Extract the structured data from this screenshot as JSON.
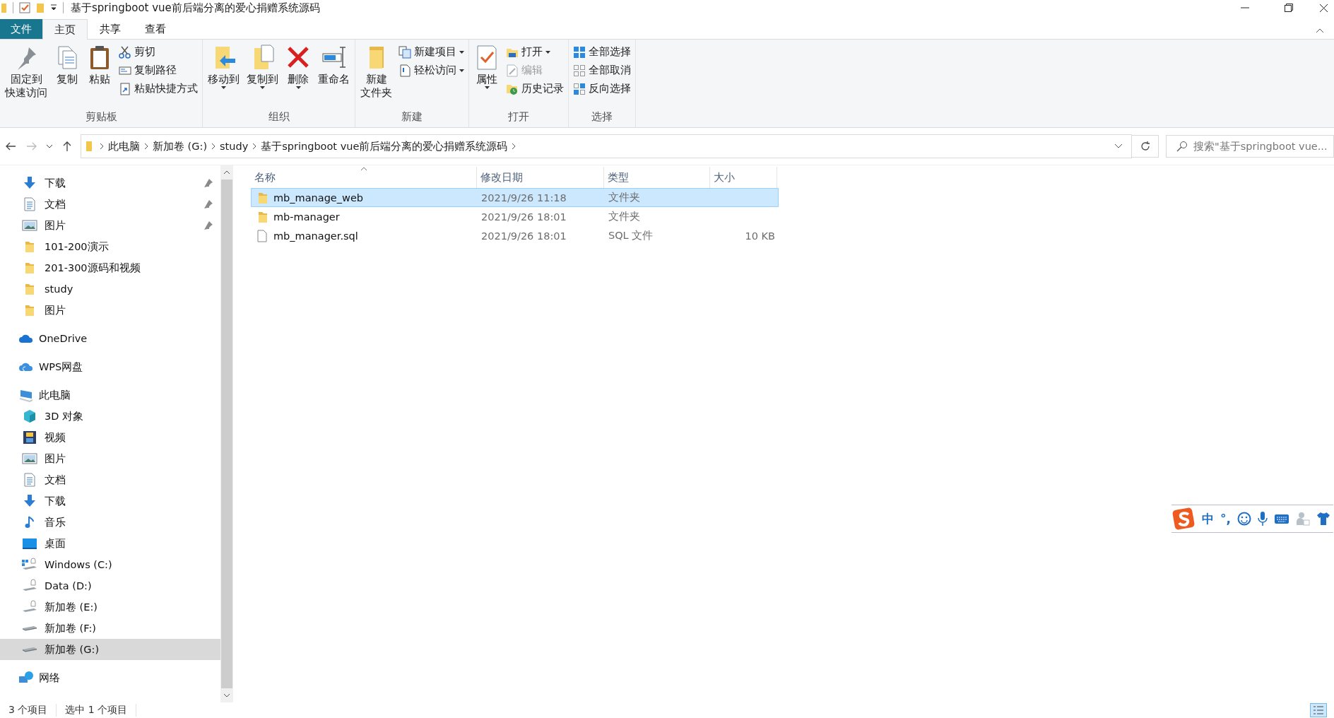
{
  "window": {
    "title": "基于springboot vue前后端分离的爱心捐赠系统源码"
  },
  "ribbon_tabs": [
    {
      "label": "文件",
      "kind": "file",
      "selected": false
    },
    {
      "label": "主页",
      "kind": "tab",
      "selected": true
    },
    {
      "label": "共享",
      "kind": "tab",
      "selected": false
    },
    {
      "label": "查看",
      "kind": "tab",
      "selected": false
    }
  ],
  "ribbon_groups": [
    {
      "label": "剪贴板",
      "items": [
        {
          "label_lines": [
            "固定到",
            "快速访问"
          ],
          "kind": "large",
          "dropdown": false,
          "disabled": false
        },
        {
          "label_lines": [
            "复制"
          ],
          "kind": "large",
          "dropdown": false,
          "disabled": false
        },
        {
          "label_lines": [
            "粘贴"
          ],
          "kind": "large",
          "dropdown": false,
          "disabled": false
        },
        {
          "label": "剪切",
          "kind": "small",
          "dropdown": false,
          "disabled": false
        },
        {
          "label": "复制路径",
          "kind": "small",
          "dropdown": false,
          "disabled": false
        },
        {
          "label": "粘贴快捷方式",
          "kind": "small",
          "dropdown": false,
          "disabled": false
        }
      ]
    },
    {
      "label": "组织",
      "items": [
        {
          "label_lines": [
            "移动到"
          ],
          "kind": "large",
          "dropdown": true,
          "disabled": false
        },
        {
          "label_lines": [
            "复制到"
          ],
          "kind": "large",
          "dropdown": true,
          "disabled": false
        },
        {
          "label_lines": [
            "删除"
          ],
          "kind": "large",
          "dropdown": true,
          "disabled": false
        },
        {
          "label_lines": [
            "重命名"
          ],
          "kind": "large",
          "dropdown": false,
          "disabled": false
        }
      ]
    },
    {
      "label": "新建",
      "items": [
        {
          "label_lines": [
            "新建",
            "文件夹"
          ],
          "kind": "large",
          "dropdown": false,
          "disabled": false
        },
        {
          "label": "新建项目",
          "kind": "small",
          "dropdown": true,
          "disabled": false
        },
        {
          "label": "轻松访问",
          "kind": "small",
          "dropdown": true,
          "disabled": false
        }
      ]
    },
    {
      "label": "打开",
      "items": [
        {
          "label_lines": [
            "属性"
          ],
          "kind": "large",
          "dropdown": true,
          "disabled": false
        },
        {
          "label": "打开",
          "kind": "small",
          "dropdown": true,
          "disabled": false
        },
        {
          "label": "编辑",
          "kind": "small",
          "dropdown": false,
          "disabled": true
        },
        {
          "label": "历史记录",
          "kind": "small",
          "dropdown": false,
          "disabled": false
        }
      ]
    },
    {
      "label": "选择",
      "items": [
        {
          "label": "全部选择",
          "kind": "small",
          "dropdown": false,
          "disabled": false
        },
        {
          "label": "全部取消",
          "kind": "small",
          "dropdown": false,
          "disabled": false
        },
        {
          "label": "反向选择",
          "kind": "small",
          "dropdown": false,
          "disabled": false
        }
      ]
    }
  ],
  "address_bar": {
    "path": [
      "此电脑",
      "新加卷 (G:)",
      "study",
      "基于springboot vue前后端分离的爱心捐赠系统源码"
    ],
    "search": {
      "placeholder": "搜索\"基于springboot vue..."
    }
  },
  "nav_pane": {
    "quick_access": [
      {
        "label": "下载",
        "pinned": true,
        "selected": false
      },
      {
        "label": "文档",
        "pinned": true,
        "selected": false
      },
      {
        "label": "图片",
        "pinned": true,
        "selected": false
      },
      {
        "label": "101-200演示",
        "pinned": false,
        "selected": false
      },
      {
        "label": "201-300源码和视频",
        "pinned": false,
        "selected": false
      },
      {
        "label": "study",
        "pinned": false,
        "selected": false
      },
      {
        "label": "图片",
        "pinned": false,
        "selected": false
      }
    ],
    "locations": [
      {
        "label": "OneDrive",
        "selected": false
      },
      {
        "label": "WPS网盘",
        "selected": false
      },
      {
        "label": "此电脑",
        "selected": false,
        "children": [
          {
            "label": "3D 对象",
            "selected": false
          },
          {
            "label": "视频",
            "selected": false
          },
          {
            "label": "图片",
            "selected": false
          },
          {
            "label": "文档",
            "selected": false
          },
          {
            "label": "下载",
            "selected": false
          },
          {
            "label": "音乐",
            "selected": false
          },
          {
            "label": "桌面",
            "selected": false
          },
          {
            "label": "Windows (C:)",
            "selected": false
          },
          {
            "label": "Data (D:)",
            "selected": false
          },
          {
            "label": "新加卷 (E:)",
            "selected": false
          },
          {
            "label": "新加卷 (F:)",
            "selected": false
          },
          {
            "label": "新加卷 (G:)",
            "selected": true
          }
        ]
      },
      {
        "label": "网络",
        "selected": false
      }
    ]
  },
  "file_list": {
    "columns": [
      {
        "label": "名称",
        "sorted": true
      },
      {
        "label": "修改日期",
        "sorted": false
      },
      {
        "label": "类型",
        "sorted": false
      },
      {
        "label": "大小",
        "sorted": false
      }
    ],
    "rows": [
      {
        "kind": "folder",
        "name": "mb_manage_web",
        "date": "2021/9/26 11:18",
        "type": "文件夹",
        "selected": true
      },
      {
        "kind": "folder",
        "name": "mb-manager",
        "date": "2021/9/26 18:01",
        "type": "文件夹",
        "selected": false
      },
      {
        "kind": "file",
        "name": "mb_manager.sql",
        "date": "2021/9/26 18:01",
        "type": "SQL 文件",
        "size": "10 KB",
        "selected": false
      }
    ]
  },
  "status_bar": {
    "item_count": "3 个项目",
    "selection": "选中 1 个项目"
  },
  "ime_toolbar": {
    "mode": "中",
    "punctuation": "°,"
  }
}
